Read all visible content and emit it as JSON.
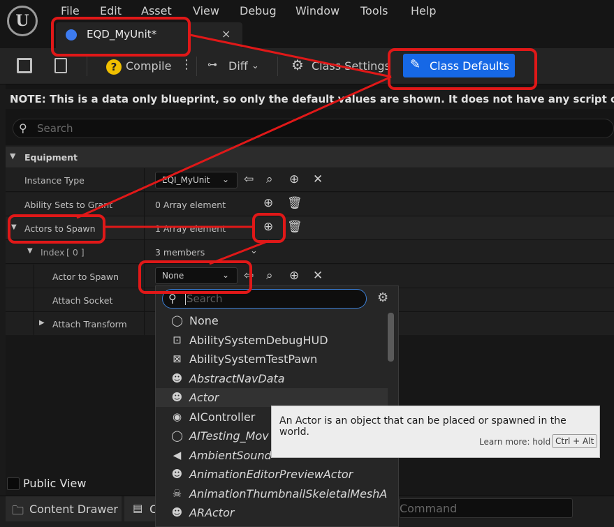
{
  "menu": [
    "File",
    "Edit",
    "Asset",
    "View",
    "Debug",
    "Window",
    "Tools",
    "Help"
  ],
  "tab": {
    "label": "EQD_MyUnit*",
    "close": "×"
  },
  "toolbar": {
    "compile_label": "Compile",
    "diff_label": "Diff",
    "class_settings_label": "Class Settings",
    "class_defaults_label": "Class Defaults"
  },
  "note": "NOTE: This is a data only blueprint, so only the default values are shown.  It does not have any script or variables.",
  "search": {
    "placeholder": "Search"
  },
  "details": {
    "category": "Equipment",
    "instance_type": {
      "label": "Instance Type",
      "value": "EQI_MyUnit"
    },
    "ability_sets": {
      "label": "Ability Sets to Grant",
      "value": "0 Array element"
    },
    "actors_to_spawn": {
      "label": "Actors to Spawn",
      "value": "1 Array element"
    },
    "index0": {
      "label": "Index",
      "index": "[ 0 ]",
      "value": "3 members"
    },
    "actor_to_spawn": {
      "label": "Actor to Spawn",
      "value": "None"
    },
    "attach_socket": {
      "label": "Attach Socket"
    },
    "attach_transform": {
      "label": "Attach Transform"
    }
  },
  "picker": {
    "search_placeholder": "Search",
    "options": [
      {
        "label": "None",
        "italic": false,
        "icon": "circle-icon"
      },
      {
        "label": "AbilitySystemDebugHUD",
        "italic": false,
        "icon": "hud-icon"
      },
      {
        "label": "AbilitySystemTestPawn",
        "italic": false,
        "icon": "pawn-icon"
      },
      {
        "label": "AbstractNavData",
        "italic": true,
        "icon": "actor-icon"
      },
      {
        "label": "Actor",
        "italic": true,
        "icon": "actor-icon"
      },
      {
        "label": "AIController",
        "italic": false,
        "icon": "controller-icon"
      },
      {
        "label": "AITesting_Mov",
        "italic": true,
        "icon": "circle-icon"
      },
      {
        "label": "AmbientSound",
        "italic": true,
        "icon": "speaker-icon"
      },
      {
        "label": "AnimationEditorPreviewActor",
        "italic": true,
        "icon": "actor-icon"
      },
      {
        "label": "AnimationThumbnailSkeletalMeshA",
        "italic": true,
        "icon": "skeleton-icon"
      },
      {
        "label": "ARActor",
        "italic": true,
        "icon": "actor-icon"
      }
    ]
  },
  "tooltip": {
    "text": "An Actor is an object that can be placed or spawned in the world.",
    "learn_more": "Learn more: hold",
    "shortcut": "Ctrl + Alt"
  },
  "public_view_label": "Public View",
  "statusbar": {
    "content_drawer_label": "Content Drawer",
    "second_tab_label": "C",
    "command_placeholder": "Command"
  }
}
